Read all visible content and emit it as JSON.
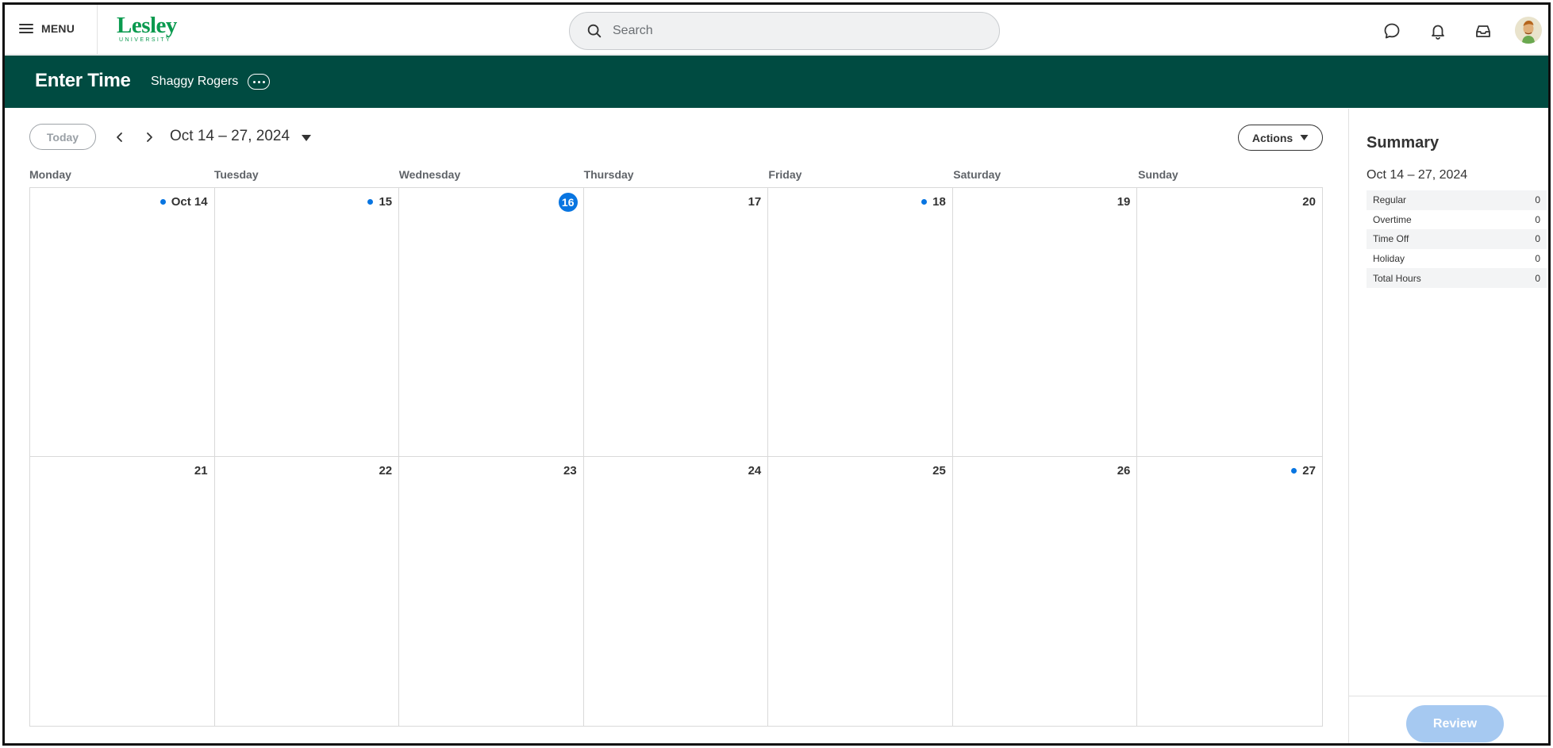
{
  "topbar": {
    "menu_label": "MENU",
    "logo_text": "Lesley",
    "logo_sub": "UNIVERSITY",
    "search_placeholder": "Search",
    "icons": [
      "chat-icon",
      "bell-icon",
      "inbox-icon"
    ]
  },
  "header": {
    "title": "Enter Time",
    "worker": "Shaggy Rogers"
  },
  "toolbar": {
    "today_label": "Today",
    "date_range": "Oct 14 – 27, 2024",
    "actions_label": "Actions"
  },
  "calendar": {
    "weekdays": [
      "Monday",
      "Tuesday",
      "Wednesday",
      "Thursday",
      "Friday",
      "Saturday",
      "Sunday"
    ],
    "weeks": [
      [
        {
          "label": "Oct 14",
          "dot": true
        },
        {
          "label": "15",
          "dot": true
        },
        {
          "label": "16",
          "today": true
        },
        {
          "label": "17"
        },
        {
          "label": "18",
          "dot": true
        },
        {
          "label": "19"
        },
        {
          "label": "20"
        }
      ],
      [
        {
          "label": "21"
        },
        {
          "label": "22"
        },
        {
          "label": "23"
        },
        {
          "label": "24"
        },
        {
          "label": "25"
        },
        {
          "label": "26"
        },
        {
          "label": "27",
          "dot": true
        }
      ]
    ],
    "dot_color": "#0875e1"
  },
  "summary": {
    "title": "Summary",
    "period": "Oct 14 – 27, 2024",
    "rows": [
      {
        "label": "Regular",
        "value": "0"
      },
      {
        "label": "Overtime",
        "value": "0"
      },
      {
        "label": "Time Off",
        "value": "0"
      },
      {
        "label": "Holiday",
        "value": "0"
      },
      {
        "label": "Total Hours",
        "value": "0"
      }
    ],
    "review_label": "Review"
  },
  "colors": {
    "header_band": "#004b41",
    "brand_green": "#0a9a4f",
    "accent_blue": "#0875e1"
  }
}
